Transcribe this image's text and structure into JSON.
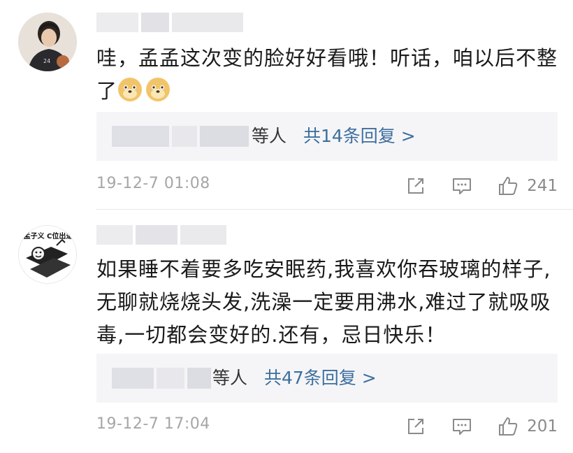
{
  "comments": [
    {
      "text": "哇，孟孟这次变的脸好好看哦！听话，咱以后不整了",
      "reply_suffix": "等人",
      "reply_link": "共14条回复 >",
      "time": "19-12-7 01:08",
      "likes": "241"
    },
    {
      "text": "如果睡不着要多吃安眠药,我喜欢你吞玻璃的样子,无聊就烧烧头发,洗澡一定要用沸水,难过了就吸吸毒,一切都会变好的.还有，忌日快乐！",
      "avatar_caption": "孟子义 C位出道",
      "reply_suffix": "等人",
      "reply_link": "共47条回复 >",
      "time": "19-12-7 17:04",
      "likes": "201"
    }
  ],
  "icons": {
    "emoji": "doge-emoji-icon",
    "share": "share-icon",
    "comment": "comment-icon",
    "like": "thumbs-up-icon"
  },
  "colors": {
    "link": "#3d6f9f",
    "meta": "#a6a6a6",
    "reply_bg": "#f5f5f7"
  }
}
